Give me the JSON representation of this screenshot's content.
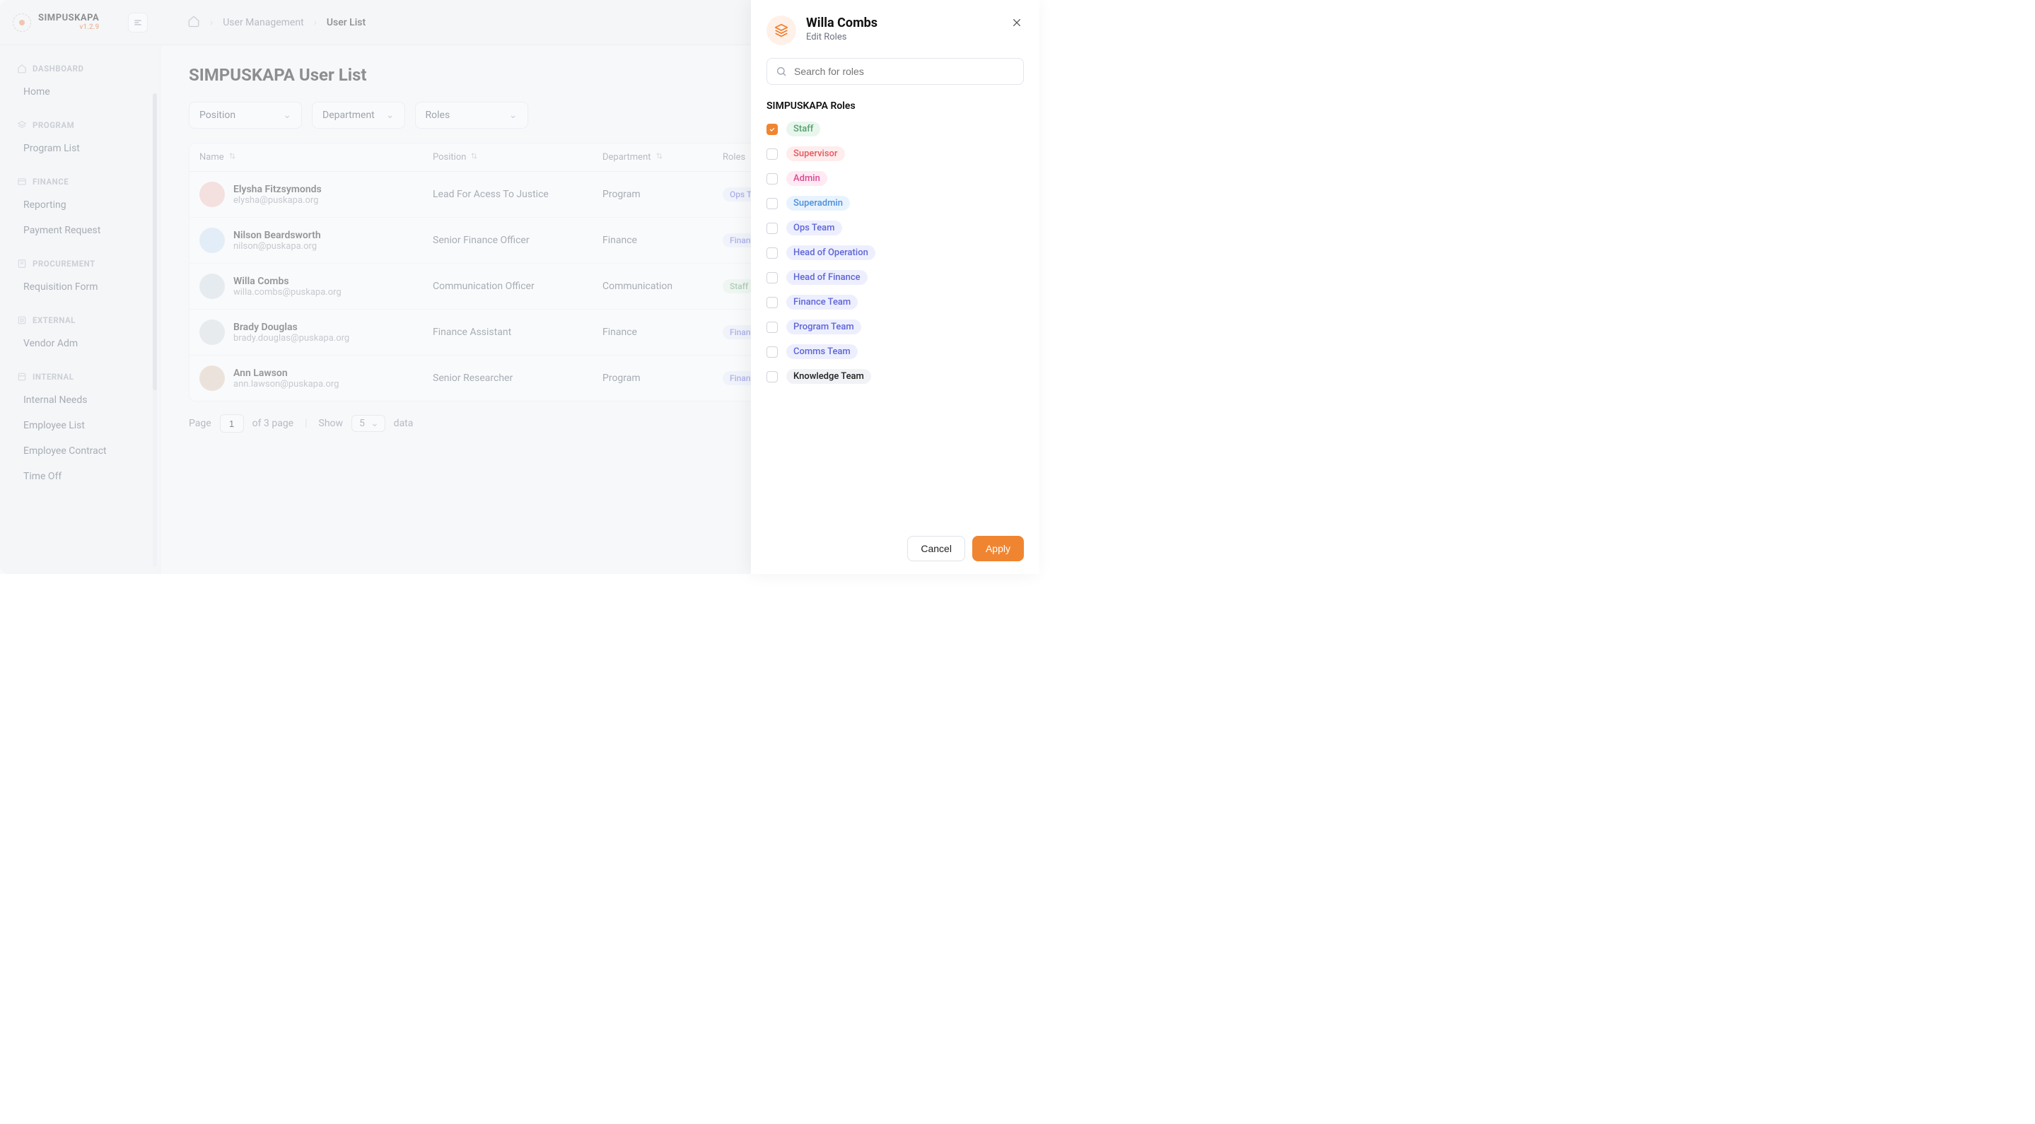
{
  "brand": {
    "name": "SIMPUSKAPA",
    "version": "v1.2.9"
  },
  "breadcrumb": {
    "l1": "User Management",
    "l2": "User List"
  },
  "page": {
    "title": "SIMPUSKAPA User List"
  },
  "sidebar": {
    "sections": [
      {
        "title": "DASHBOARD",
        "items": [
          "Home"
        ]
      },
      {
        "title": "PROGRAM",
        "items": [
          "Program List"
        ]
      },
      {
        "title": "FINANCE",
        "items": [
          "Reporting",
          "Payment Request"
        ]
      },
      {
        "title": "PROCUREMENT",
        "items": [
          "Requisition Form"
        ]
      },
      {
        "title": "EXTERNAL",
        "items": [
          "Vendor Adm"
        ]
      },
      {
        "title": "INTERNAL",
        "items": [
          "Internal Needs",
          "Employee List",
          "Employee Contract",
          "Time Off"
        ]
      }
    ]
  },
  "filters": {
    "position": "Position",
    "department": "Department",
    "roles": "Roles"
  },
  "table": {
    "headers": {
      "name": "Name",
      "position": "Position",
      "department": "Department",
      "roles": "Roles"
    },
    "rows": [
      {
        "name": "Elysha Fitzsymonds",
        "email": "elysha@puskapa.org",
        "position": "Lead For Acess To Justice",
        "department": "Program",
        "badge": "Ops Team",
        "badgeClass": "indigo",
        "avatar": "#f3c5c0"
      },
      {
        "name": "Nilson Beardsworth",
        "email": "nilson@puskapa.org",
        "position": "Senior Finance Officer",
        "department": "Finance",
        "badge": "Finance",
        "badgeClass": "indigo",
        "avatar": "#cfe3f7"
      },
      {
        "name": "Willa Combs",
        "email": "willa.combs@puskapa.org",
        "position": "Communication Officer",
        "department": "Communication",
        "badge": "Staff",
        "badgeClass": "green",
        "avatar": "#d6dde7"
      },
      {
        "name": "Brady Douglas",
        "email": "brady.douglas@puskapa.org",
        "position": "Finance Assistant",
        "department": "Finance",
        "badge": "Finance",
        "badgeClass": "indigo",
        "avatar": "#d9dde3"
      },
      {
        "name": "Ann Lawson",
        "email": "ann.lawson@puskapa.org",
        "position": "Senior Researcher",
        "department": "Program",
        "badge": "Finance",
        "badgeClass": "indigo",
        "avatar": "#e2c9bb"
      }
    ]
  },
  "pagination": {
    "page_label": "Page",
    "page_value": "1",
    "of_text": "of 3 page",
    "show_label": "Show",
    "show_value": "5",
    "data_label": "data"
  },
  "drawer": {
    "title": "Willa Combs",
    "subtitle": "Edit Roles",
    "search_placeholder": "Search for roles",
    "section": "SIMPUSKAPA Roles",
    "roles": [
      {
        "label": "Staff",
        "class": "rb-staff",
        "checked": true
      },
      {
        "label": "Supervisor",
        "class": "rb-supervisor",
        "checked": false
      },
      {
        "label": "Admin",
        "class": "rb-admin",
        "checked": false
      },
      {
        "label": "Superadmin",
        "class": "rb-superadmin",
        "checked": false
      },
      {
        "label": "Ops Team",
        "class": "rb-ops",
        "checked": false
      },
      {
        "label": "Head of Operation",
        "class": "rb-headop",
        "checked": false
      },
      {
        "label": "Head of Finance",
        "class": "rb-headfin",
        "checked": false
      },
      {
        "label": "Finance Team",
        "class": "rb-fin",
        "checked": false
      },
      {
        "label": "Program Team",
        "class": "rb-prog",
        "checked": false
      },
      {
        "label": "Comms Team",
        "class": "rb-comms",
        "checked": false
      },
      {
        "label": "Knowledge Team",
        "class": "rb-knowledge",
        "checked": false
      }
    ],
    "cancel": "Cancel",
    "apply": "Apply"
  }
}
